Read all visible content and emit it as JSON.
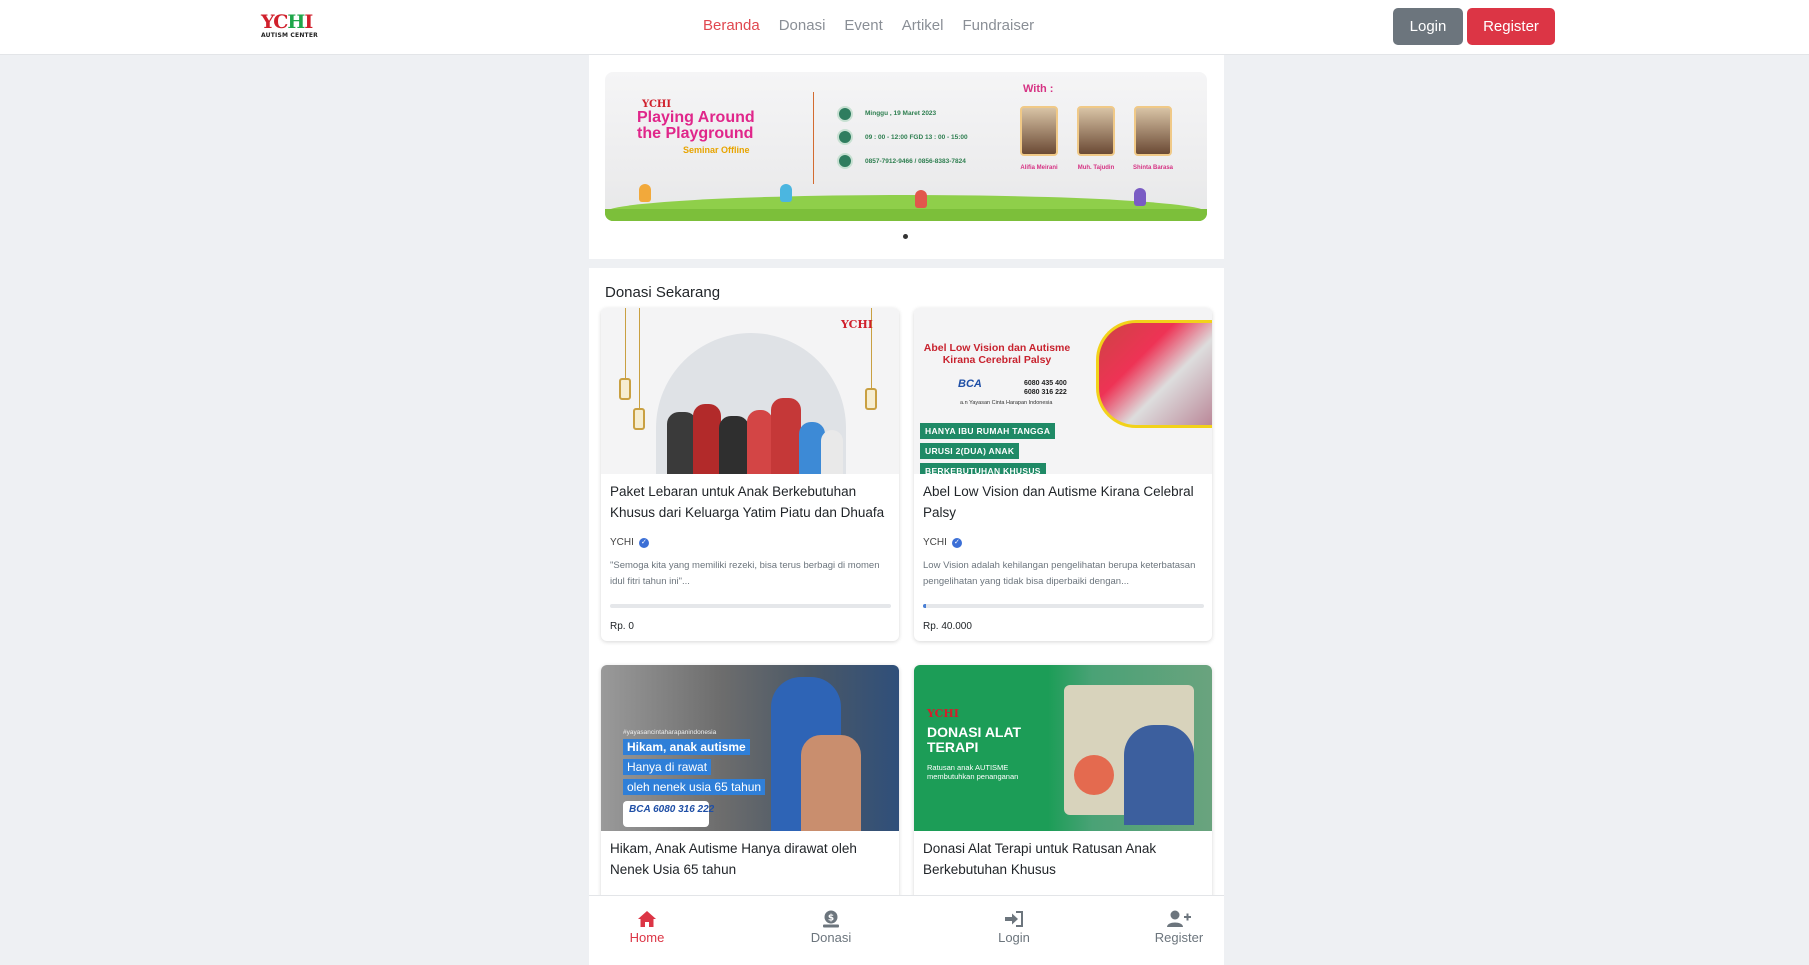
{
  "brand": {
    "logo_mark": "YCHI",
    "logo_sub": "AUTISM CENTER"
  },
  "nav": {
    "items": [
      {
        "label": "Beranda",
        "active": true
      },
      {
        "label": "Donasi",
        "active": false
      },
      {
        "label": "Event",
        "active": false
      },
      {
        "label": "Artikel",
        "active": false
      },
      {
        "label": "Fundraiser",
        "active": false
      }
    ]
  },
  "auth": {
    "login_label": "Login",
    "register_label": "Register"
  },
  "banner": {
    "logo": "YCHI",
    "title": "Playing Around the Playground",
    "subtitle": "Seminar Offline",
    "date": "Minggu , 19 Maret 2023",
    "time": "09 : 00 - 12:00    FGD  13 : 00 - 15:00",
    "phone": "0857-7912-9466 / 0856-8383-7824",
    "with_label": "With :",
    "speakers": [
      "Alifia Meirani",
      "Muh. Tajudin",
      "Shinta Barasa"
    ]
  },
  "donasi": {
    "section_title": "Donasi Sekarang",
    "cards": [
      {
        "title": "Paket Lebaran untuk Anak Berkebutuhan Khusus dari Keluarga Yatim Piatu dan Dhuafa",
        "org": "YCHI",
        "desc": "\"Semoga kita yang memiliki rezeki, bisa terus berbagi di momen idul fitri tahun ini\"...",
        "amount": "Rp. 0",
        "progress": 0,
        "thumb_logo": "YCHI"
      },
      {
        "title": "Abel Low Vision dan Autisme Kirana Celebral Palsy",
        "org": "YCHI",
        "desc": "Low Vision adalah kehilangan pengelihatan berupa keterbatasan pengelihatan yang tidak bisa diperbaiki dengan...",
        "amount": "Rp. 40.000",
        "progress": 0.01,
        "thumb_title": "Abel Low Vision dan Autisme Kirana Cerebral Palsy",
        "thumb_bca": "BCA",
        "thumb_acc1": "6080 435 400",
        "thumb_acc2": "6080 316 222",
        "thumb_an": "a.n Yayasan Cinta Harapan Indonesia",
        "thumb_tags": [
          "HANYA IBU RUMAH TANGGA",
          "URUSI 2(DUA) ANAK",
          "BERKEBUTUHAN KHUSUS"
        ]
      },
      {
        "title": "Hikam, Anak Autisme Hanya dirawat oleh Nenek Usia 65 tahun",
        "thumb_hash": "#yayasancintaharapanindonesia",
        "thumb_tags": [
          "Hikam, anak autisme",
          "Hanya di rawat",
          "oleh nenek usia 65 tahun"
        ],
        "thumb_bca": "BCA 6080 316 222"
      },
      {
        "title": "Donasi Alat Terapi untuk Ratusan Anak Berkebutuhan Khusus",
        "thumb_logo": "YCHI",
        "thumb_heading": "DONASI ALAT TERAPI",
        "thumb_sub": "Ratusan anak AUTISME membutuhkan penanganan"
      }
    ]
  },
  "bottom_nav": [
    {
      "label": "Home",
      "icon": "home-icon",
      "active": true
    },
    {
      "label": "Donasi",
      "icon": "donation-icon",
      "active": false
    },
    {
      "label": "Login",
      "icon": "login-icon",
      "active": false
    },
    {
      "label": "Register",
      "icon": "user-plus-icon",
      "active": false
    }
  ],
  "colors": {
    "accent": "#dc3545",
    "login_btn": "#6c757d",
    "progress": "#4a7fd4"
  }
}
